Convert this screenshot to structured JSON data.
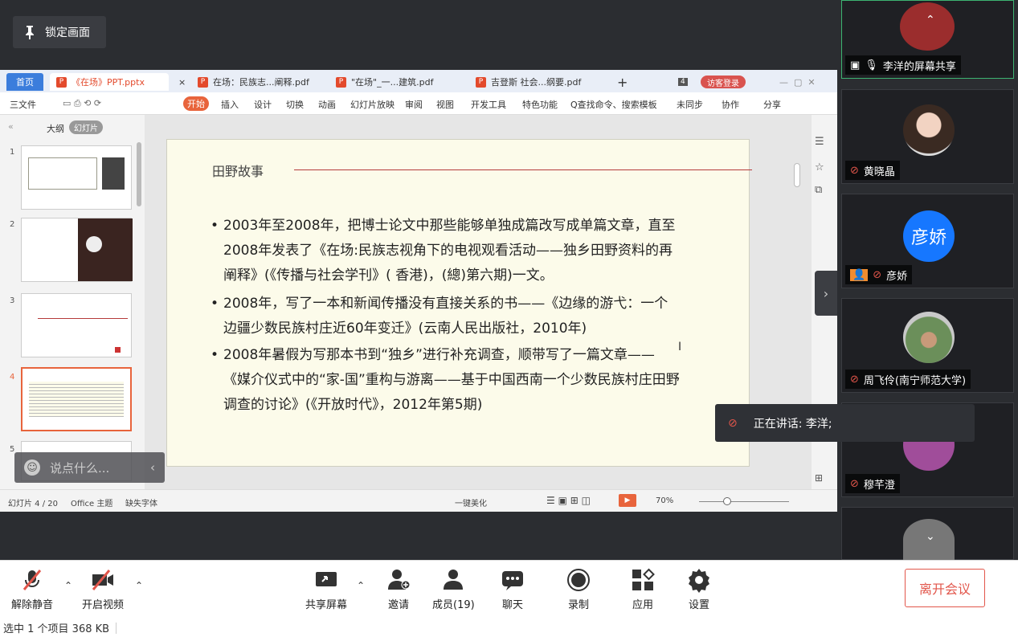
{
  "meeting": {
    "lock_label": "锁定画面",
    "share_label": "李洋的屏幕共享",
    "speaking": "正在讲话: 李洋;",
    "chat_placeholder": "说点什么..."
  },
  "wps": {
    "tabs": {
      "home": "首页",
      "t1": "《在场》PPT.pptx",
      "t2": "在场：民族志...阐释.pdf",
      "t3": "\"在场\"_一...建筑.pdf",
      "t4": "吉登斯 社会...纲要.pdf",
      "badge": "4",
      "visitor": "访客登录"
    },
    "menu": {
      "file": "三文件",
      "start": "开始",
      "items": [
        "插入",
        "设计",
        "切换",
        "动画",
        "幻灯片放映",
        "审阅",
        "视图",
        "开发工具",
        "特色功能"
      ],
      "search": "Q查找命令、搜索模板",
      "sync": "未同步",
      "collab": "协作",
      "share": "分享"
    },
    "left_tabs": {
      "outline": "大纲",
      "slides": "幻灯片"
    },
    "thumb_nums": [
      "1",
      "2",
      "3",
      "4",
      "5"
    ],
    "slide": {
      "title": "田野故事",
      "bullets": [
        "2003年至2008年，把博士论文中那些能够单独成篇改写成单篇文章，直至2008年发表了《在场:民族志视角下的电视观看活动——独乡田野资料的再阐释》(《传播与社会学刊》( 香港)，(總)第六期)一文。",
        "2008年，写了一本和新闻传播没有直接关系的书——《边缘的游弋：一个边疆少数民族村庄近60年变迁》(云南人民出版社，2010年)",
        "2008年暑假为写那本书到“独乡”进行补充调查，顺带写了一篇文章——《媒介仪式中的“家-国”重构与游离——基于中国西南一个少数民族村庄田野调查的讨论》(《开放时代》，2012年第5期)"
      ]
    },
    "status": {
      "slide_count": "幻灯片 4 / 20",
      "theme": "Office 主题",
      "font": "缺失字体",
      "beautify": "一键美化",
      "zoom": "70%"
    }
  },
  "participants": [
    {
      "name": "黄晓晶"
    },
    {
      "name": "彦娇",
      "avatar_text": "彦娇"
    },
    {
      "name": "周飞伶(南宁师范大学)"
    },
    {
      "name": "穆芊澄"
    }
  ],
  "toolbar": {
    "unmute": "解除静音",
    "video": "开启视频",
    "share": "共享屏幕",
    "invite": "邀请",
    "members": "成员(19)",
    "chat": "聊天",
    "record": "录制",
    "apps": "应用",
    "settings": "设置",
    "leave": "离开会议"
  },
  "explorer_status": "选中 1 个项目  368 KB",
  "colors": {
    "wps_accent": "#e8643c",
    "mute_red": "#e2564b",
    "avatar_blue": "#1677ff"
  }
}
